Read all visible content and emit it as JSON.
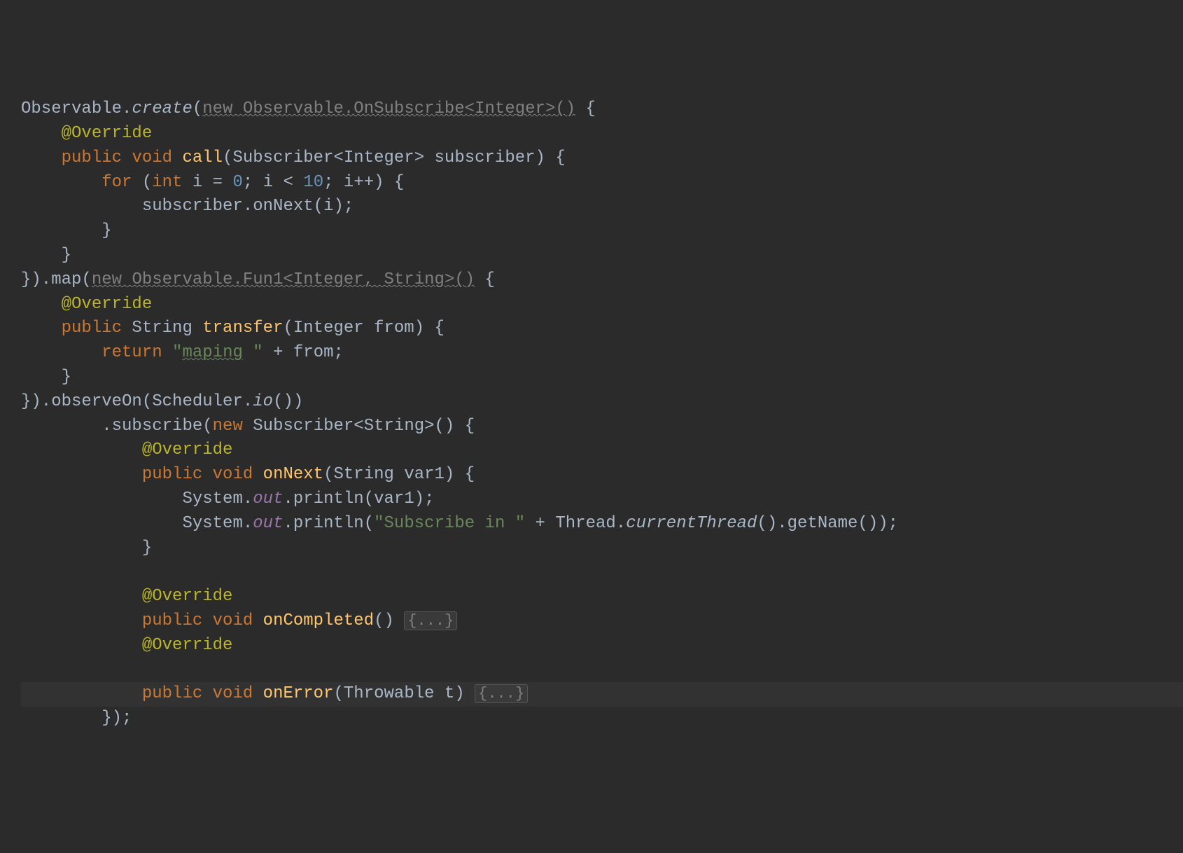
{
  "code": {
    "l1_class": "Observable",
    "l1_method": "create",
    "l1_gray": "new Observable.OnSubscribe<Integer>()",
    "l1_brace": " {",
    "l2_anno": "@Override",
    "l3_pub": "public",
    "l3_void": "void",
    "l3_name": "call",
    "l3_sig": "(Subscriber<Integer> subscriber) {",
    "l4_for": "for",
    "l4_paren": " (",
    "l4_int": "int",
    "l4_i_eq": " i = ",
    "l4_zero": "0",
    "l4_mid": "; i < ",
    "l4_ten": "10",
    "l4_end": "; i++) {",
    "l5": "subscriber.onNext(i);",
    "l6": "}",
    "l7": "}",
    "l8_pre": "}).map(",
    "l8_gray": "new Observable.Fun1<Integer, String>()",
    "l8_brace": " {",
    "l9_anno": "@Override",
    "l10_pub": "public",
    "l10_type": " String ",
    "l10_name": "transfer",
    "l10_sig": "(Integer from) {",
    "l11_ret": "return",
    "l11_q1": " \"",
    "l11_typo": "maping",
    "l11_q2": " \"",
    "l11_plus": " + from;",
    "l12": "}",
    "l13_pre": "}).observeOn(Scheduler.",
    "l13_io": "io",
    "l13_post": "())",
    "l14_pre": ".subscribe(",
    "l14_new": "new",
    "l14_post": " Subscriber<String>() {",
    "l15_anno": "@Override",
    "l16_pub": "public",
    "l16_void": "void",
    "l16_name": "onNext",
    "l16_sig": "(String var1) {",
    "l17_pre": "System.",
    "l17_out": "out",
    "l17_post": ".println(var1);",
    "l18_pre": "System.",
    "l18_out": "out",
    "l18_mid": ".println(",
    "l18_str": "\"Subscribe in \"",
    "l18_plus": " + Thread.",
    "l18_cur": "currentThread",
    "l18_post": "().getName());",
    "l19": "}",
    "l21_anno": "@Override",
    "l22_pub": "public",
    "l22_void": "void",
    "l22_name": "onCompleted",
    "l22_sig": "() ",
    "l22_fold": "{...}",
    "l23_anno": "@Override",
    "l25_pub": "public",
    "l25_void": "void",
    "l25_name": "onError",
    "l25_sig": "(Throwable t) ",
    "l25_fold": "{...}",
    "l26": "});"
  }
}
